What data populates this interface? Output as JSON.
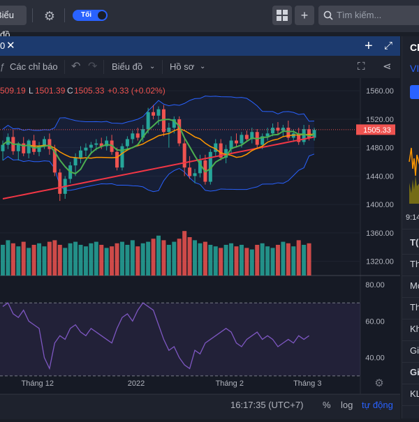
{
  "topbar": {
    "tab_label": "Biểu đồ",
    "theme_toggle_label": "Tối",
    "search_placeholder": "Tìm kiếm..."
  },
  "chart_header": {
    "symbol_fragment": "0",
    "close_glyph": "✕"
  },
  "toolbar": {
    "indicators_label": "Các chỉ báo",
    "chart_menu_label": "Biểu đồ",
    "profile_menu_label": "Hồ sơ"
  },
  "ohlc": {
    "open_fragment": "509.19",
    "low_label": "L",
    "low_value": "1501.39",
    "close_label": "C",
    "close_value": "1505.33",
    "change": "+0.33 (+0.02%)"
  },
  "price_axis": {
    "ticks": [
      "1560.00",
      "1520.00",
      "1480.00",
      "1440.00",
      "1400.00",
      "1360.00",
      "1320.00"
    ],
    "last_price": "1505.33"
  },
  "rsi_axis": {
    "ticks": [
      "80.00",
      "60.00",
      "40.00"
    ]
  },
  "time_axis": {
    "ticks": [
      "Tháng 12",
      "2022",
      "Tháng 2",
      "Tháng 3"
    ]
  },
  "footer": {
    "clock": "16:17:35 (UTC+7)",
    "percent_label": "%",
    "log_label": "log",
    "auto_label": "tự động"
  },
  "right_panel": {
    "title_fragment": "Cl",
    "subtitle_fragment": "VI",
    "time_fragment": "9:14",
    "rows": [
      "T(",
      "Th",
      "Mở",
      "Th",
      "Kh",
      "Gia",
      "Gi",
      "KL"
    ]
  },
  "colors": {
    "up": "#26a69a",
    "down": "#ef5350",
    "band": "#2962ff",
    "ma_fast": "#4caf50",
    "ma_mid": "#ff9800",
    "ma_slow": "#f23645",
    "rsi": "#7e57c2",
    "accent": "#2962ff"
  },
  "chart_data": {
    "type": "candlestick",
    "price_ylim": [
      1300,
      1570
    ],
    "candles": [
      {
        "o": 1475,
        "h": 1490,
        "l": 1462,
        "c": 1484
      },
      {
        "o": 1484,
        "h": 1500,
        "l": 1478,
        "c": 1495
      },
      {
        "o": 1495,
        "h": 1505,
        "l": 1470,
        "c": 1475
      },
      {
        "o": 1475,
        "h": 1488,
        "l": 1462,
        "c": 1486
      },
      {
        "o": 1486,
        "h": 1495,
        "l": 1468,
        "c": 1472
      },
      {
        "o": 1472,
        "h": 1492,
        "l": 1465,
        "c": 1490
      },
      {
        "o": 1490,
        "h": 1498,
        "l": 1470,
        "c": 1474
      },
      {
        "o": 1474,
        "h": 1488,
        "l": 1468,
        "c": 1482
      },
      {
        "o": 1482,
        "h": 1496,
        "l": 1478,
        "c": 1492
      },
      {
        "o": 1492,
        "h": 1500,
        "l": 1470,
        "c": 1478
      },
      {
        "o": 1478,
        "h": 1484,
        "l": 1440,
        "c": 1445
      },
      {
        "o": 1445,
        "h": 1450,
        "l": 1405,
        "c": 1415
      },
      {
        "o": 1415,
        "h": 1440,
        "l": 1408,
        "c": 1436
      },
      {
        "o": 1436,
        "h": 1460,
        "l": 1430,
        "c": 1455
      },
      {
        "o": 1455,
        "h": 1472,
        "l": 1440,
        "c": 1466
      },
      {
        "o": 1466,
        "h": 1482,
        "l": 1458,
        "c": 1476
      },
      {
        "o": 1476,
        "h": 1486,
        "l": 1468,
        "c": 1480
      },
      {
        "o": 1480,
        "h": 1488,
        "l": 1472,
        "c": 1484
      },
      {
        "o": 1484,
        "h": 1492,
        "l": 1476,
        "c": 1486
      },
      {
        "o": 1486,
        "h": 1494,
        "l": 1478,
        "c": 1482
      },
      {
        "o": 1482,
        "h": 1496,
        "l": 1476,
        "c": 1490
      },
      {
        "o": 1490,
        "h": 1498,
        "l": 1470,
        "c": 1474
      },
      {
        "o": 1474,
        "h": 1480,
        "l": 1448,
        "c": 1452
      },
      {
        "o": 1452,
        "h": 1486,
        "l": 1448,
        "c": 1482
      },
      {
        "o": 1482,
        "h": 1496,
        "l": 1476,
        "c": 1492
      },
      {
        "o": 1492,
        "h": 1504,
        "l": 1486,
        "c": 1500
      },
      {
        "o": 1500,
        "h": 1508,
        "l": 1490,
        "c": 1494
      },
      {
        "o": 1494,
        "h": 1512,
        "l": 1488,
        "c": 1506
      },
      {
        "o": 1506,
        "h": 1536,
        "l": 1500,
        "c": 1530
      },
      {
        "o": 1530,
        "h": 1540,
        "l": 1520,
        "c": 1525
      },
      {
        "o": 1525,
        "h": 1538,
        "l": 1512,
        "c": 1534
      },
      {
        "o": 1534,
        "h": 1540,
        "l": 1496,
        "c": 1502
      },
      {
        "o": 1502,
        "h": 1515,
        "l": 1480,
        "c": 1508
      },
      {
        "o": 1508,
        "h": 1524,
        "l": 1500,
        "c": 1520
      },
      {
        "o": 1520,
        "h": 1524,
        "l": 1482,
        "c": 1486
      },
      {
        "o": 1486,
        "h": 1492,
        "l": 1440,
        "c": 1452
      },
      {
        "o": 1452,
        "h": 1468,
        "l": 1436,
        "c": 1440
      },
      {
        "o": 1440,
        "h": 1450,
        "l": 1430,
        "c": 1444
      },
      {
        "o": 1444,
        "h": 1470,
        "l": 1438,
        "c": 1462
      },
      {
        "o": 1462,
        "h": 1470,
        "l": 1428,
        "c": 1432
      },
      {
        "o": 1432,
        "h": 1478,
        "l": 1428,
        "c": 1474
      },
      {
        "o": 1474,
        "h": 1492,
        "l": 1468,
        "c": 1486
      },
      {
        "o": 1486,
        "h": 1492,
        "l": 1462,
        "c": 1466
      },
      {
        "o": 1466,
        "h": 1484,
        "l": 1458,
        "c": 1478
      },
      {
        "o": 1478,
        "h": 1496,
        "l": 1472,
        "c": 1490
      },
      {
        "o": 1490,
        "h": 1500,
        "l": 1480,
        "c": 1486
      },
      {
        "o": 1486,
        "h": 1502,
        "l": 1480,
        "c": 1498
      },
      {
        "o": 1498,
        "h": 1504,
        "l": 1488,
        "c": 1492
      },
      {
        "o": 1492,
        "h": 1508,
        "l": 1486,
        "c": 1502
      },
      {
        "o": 1502,
        "h": 1506,
        "l": 1478,
        "c": 1484
      },
      {
        "o": 1484,
        "h": 1500,
        "l": 1478,
        "c": 1496
      },
      {
        "o": 1496,
        "h": 1508,
        "l": 1490,
        "c": 1500
      },
      {
        "o": 1500,
        "h": 1514,
        "l": 1496,
        "c": 1508
      },
      {
        "o": 1508,
        "h": 1516,
        "l": 1498,
        "c": 1504
      },
      {
        "o": 1504,
        "h": 1512,
        "l": 1496,
        "c": 1508
      },
      {
        "o": 1508,
        "h": 1518,
        "l": 1490,
        "c": 1494
      },
      {
        "o": 1494,
        "h": 1506,
        "l": 1488,
        "c": 1500
      },
      {
        "o": 1500,
        "h": 1508,
        "l": 1484,
        "c": 1488
      },
      {
        "o": 1488,
        "h": 1512,
        "l": 1484,
        "c": 1506
      },
      {
        "o": 1506,
        "h": 1512,
        "l": 1490,
        "c": 1494
      },
      {
        "o": 1494,
        "h": 1508,
        "l": 1490,
        "c": 1505
      }
    ],
    "volume": [
      40,
      46,
      42,
      38,
      44,
      36,
      40,
      42,
      38,
      44,
      46,
      40,
      36,
      42,
      44,
      40,
      38,
      42,
      44,
      40,
      36,
      38,
      42,
      44,
      40,
      46,
      38,
      42,
      44,
      48,
      52,
      46,
      40,
      44,
      48,
      58,
      50,
      46,
      42,
      44,
      40,
      38,
      36,
      40,
      42,
      38,
      40,
      36,
      34,
      40,
      42,
      38,
      36,
      40,
      44,
      42,
      38,
      46,
      40,
      42
    ],
    "rsi": [
      68,
      70,
      64,
      62,
      66,
      60,
      58,
      56,
      40,
      34,
      48,
      52,
      50,
      56,
      58,
      54,
      52,
      56,
      54,
      52,
      50,
      48,
      56,
      62,
      64,
      60,
      66,
      70,
      68,
      66,
      58,
      50,
      44,
      46,
      40,
      36,
      34,
      44,
      42,
      48,
      50,
      52,
      54,
      56,
      54,
      48,
      46,
      50,
      52,
      54,
      50,
      52,
      50,
      46,
      48,
      50,
      48,
      52,
      50,
      52
    ],
    "rsi_ylim": [
      20,
      85
    ],
    "rsi_overbought": 70,
    "rsi_oversold": 30
  }
}
